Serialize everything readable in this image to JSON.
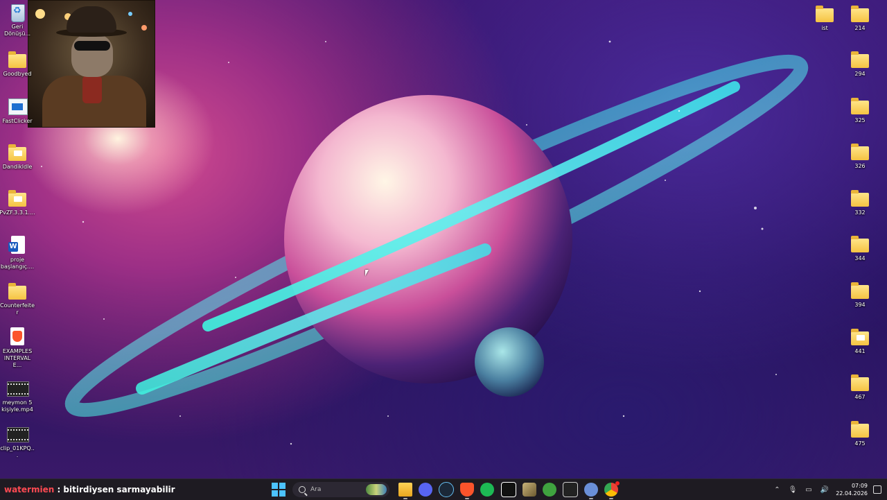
{
  "desktop_left_icons": [
    {
      "label": "Geri Dönüşü...",
      "icon": "recycle-bin-icon"
    },
    {
      "label": "Goodbyed",
      "icon": "folder-icon"
    },
    {
      "label": "FastClicker",
      "icon": "app-window-icon"
    },
    {
      "label": "Dandikldle",
      "icon": "folder-icon"
    },
    {
      "label": "PvZF.3.3.1....",
      "icon": "folder-icon"
    },
    {
      "label": "proje başlangıç....",
      "icon": "word-document-icon"
    },
    {
      "label": "Counterfeiter",
      "icon": "folder-icon"
    },
    {
      "label": "EXAMPLES INTERVAL E...",
      "icon": "pdf-brave-icon"
    },
    {
      "label": "meymon 5 kişiyle.mp4",
      "icon": "video-file-icon"
    },
    {
      "label": "clip_01KPQ...",
      "icon": "video-file-icon"
    }
  ],
  "desktop_right_icons": [
    {
      "label": "ist"
    },
    {
      "label": "214"
    },
    {
      "label": "294"
    },
    {
      "label": "325"
    },
    {
      "label": "326"
    },
    {
      "label": "332"
    },
    {
      "label": "344"
    },
    {
      "label": "394"
    },
    {
      "label": "441"
    },
    {
      "label": "467"
    },
    {
      "label": "475"
    }
  ],
  "chat": {
    "user": "watermien",
    "message": " : bitirdiysen sarmayabilir"
  },
  "taskbar": {
    "search_placeholder": "Ara",
    "apps": [
      "file-explorer-icon",
      "discord-icon",
      "steam-icon",
      "brave-icon",
      "spotify-icon",
      "capcut-icon",
      "package-icon",
      "xbox-icon",
      "epic-games-icon",
      "settings-icon",
      "chrome-icon"
    ],
    "clock_time": "07:09",
    "clock_date": "22.04.2026"
  },
  "colors": {
    "taskbar_bg": "#1e1b22",
    "chat_user": "#ff4a52",
    "start_accent": "#4cc2ff"
  }
}
